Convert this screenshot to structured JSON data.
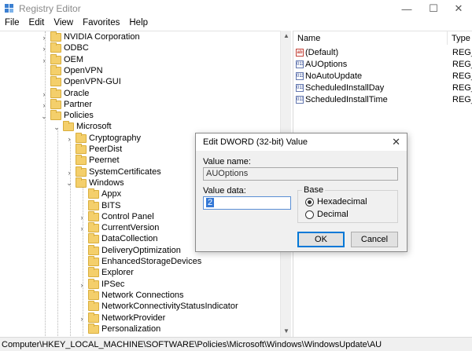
{
  "window": {
    "title": "Registry Editor",
    "minimize": "—",
    "maximize": "☐",
    "close": "✕"
  },
  "menu": [
    "File",
    "Edit",
    "View",
    "Favorites",
    "Help"
  ],
  "tree": [
    {
      "label": "NVIDIA Corporation",
      "level": 0,
      "expander": "›"
    },
    {
      "label": "ODBC",
      "level": 0,
      "expander": "›"
    },
    {
      "label": "OEM",
      "level": 0,
      "expander": "›"
    },
    {
      "label": "OpenVPN",
      "level": 0,
      "expander": ""
    },
    {
      "label": "OpenVPN-GUI",
      "level": 0,
      "expander": ""
    },
    {
      "label": "Oracle",
      "level": 0,
      "expander": "›"
    },
    {
      "label": "Partner",
      "level": 0,
      "expander": "›"
    },
    {
      "label": "Policies",
      "level": 0,
      "expander": "⌄"
    },
    {
      "label": "Microsoft",
      "level": 1,
      "expander": "⌄"
    },
    {
      "label": "Cryptography",
      "level": 2,
      "expander": "›"
    },
    {
      "label": "PeerDist",
      "level": 2,
      "expander": ""
    },
    {
      "label": "Peernet",
      "level": 2,
      "expander": ""
    },
    {
      "label": "SystemCertificates",
      "level": 2,
      "expander": "›"
    },
    {
      "label": "Windows",
      "level": 2,
      "expander": "⌄"
    },
    {
      "label": "Appx",
      "level": 3,
      "expander": ""
    },
    {
      "label": "BITS",
      "level": 3,
      "expander": ""
    },
    {
      "label": "Control Panel",
      "level": 3,
      "expander": "›"
    },
    {
      "label": "CurrentVersion",
      "level": 3,
      "expander": "›"
    },
    {
      "label": "DataCollection",
      "level": 3,
      "expander": ""
    },
    {
      "label": "DeliveryOptimization",
      "level": 3,
      "expander": ""
    },
    {
      "label": "EnhancedStorageDevices",
      "level": 3,
      "expander": ""
    },
    {
      "label": "Explorer",
      "level": 3,
      "expander": ""
    },
    {
      "label": "IPSec",
      "level": 3,
      "expander": "›"
    },
    {
      "label": "Network Connections",
      "level": 3,
      "expander": ""
    },
    {
      "label": "NetworkConnectivityStatusIndicator",
      "level": 3,
      "expander": ""
    },
    {
      "label": "NetworkProvider",
      "level": 3,
      "expander": "›"
    },
    {
      "label": "Personalization",
      "level": 3,
      "expander": ""
    }
  ],
  "list": {
    "col_name": "Name",
    "col_type": "Type",
    "rows": [
      {
        "icon": "ab",
        "name": "(Default)",
        "type": "REG_S"
      },
      {
        "icon": "bin",
        "name": "AUOptions",
        "type": "REG_D"
      },
      {
        "icon": "bin",
        "name": "NoAutoUpdate",
        "type": "REG_D"
      },
      {
        "icon": "bin",
        "name": "ScheduledInstallDay",
        "type": "REG_D"
      },
      {
        "icon": "bin",
        "name": "ScheduledInstallTime",
        "type": "REG_D"
      }
    ]
  },
  "status": "Computer\\HKEY_LOCAL_MACHINE\\SOFTWARE\\Policies\\Microsoft\\Windows\\WindowsUpdate\\AU",
  "dialog": {
    "title": "Edit DWORD (32-bit) Value",
    "value_name_label": "Value name:",
    "value_name": "AUOptions",
    "value_data_label": "Value data:",
    "value_data": "2",
    "base_label": "Base",
    "hex_label": "Hexadecimal",
    "dec_label": "Decimal",
    "selected_base": "Hexadecimal",
    "ok": "OK",
    "cancel": "Cancel"
  },
  "colors": {
    "folder": "#f4cf6b",
    "selection": "#3478d6",
    "ok_border": "#0078d7"
  }
}
